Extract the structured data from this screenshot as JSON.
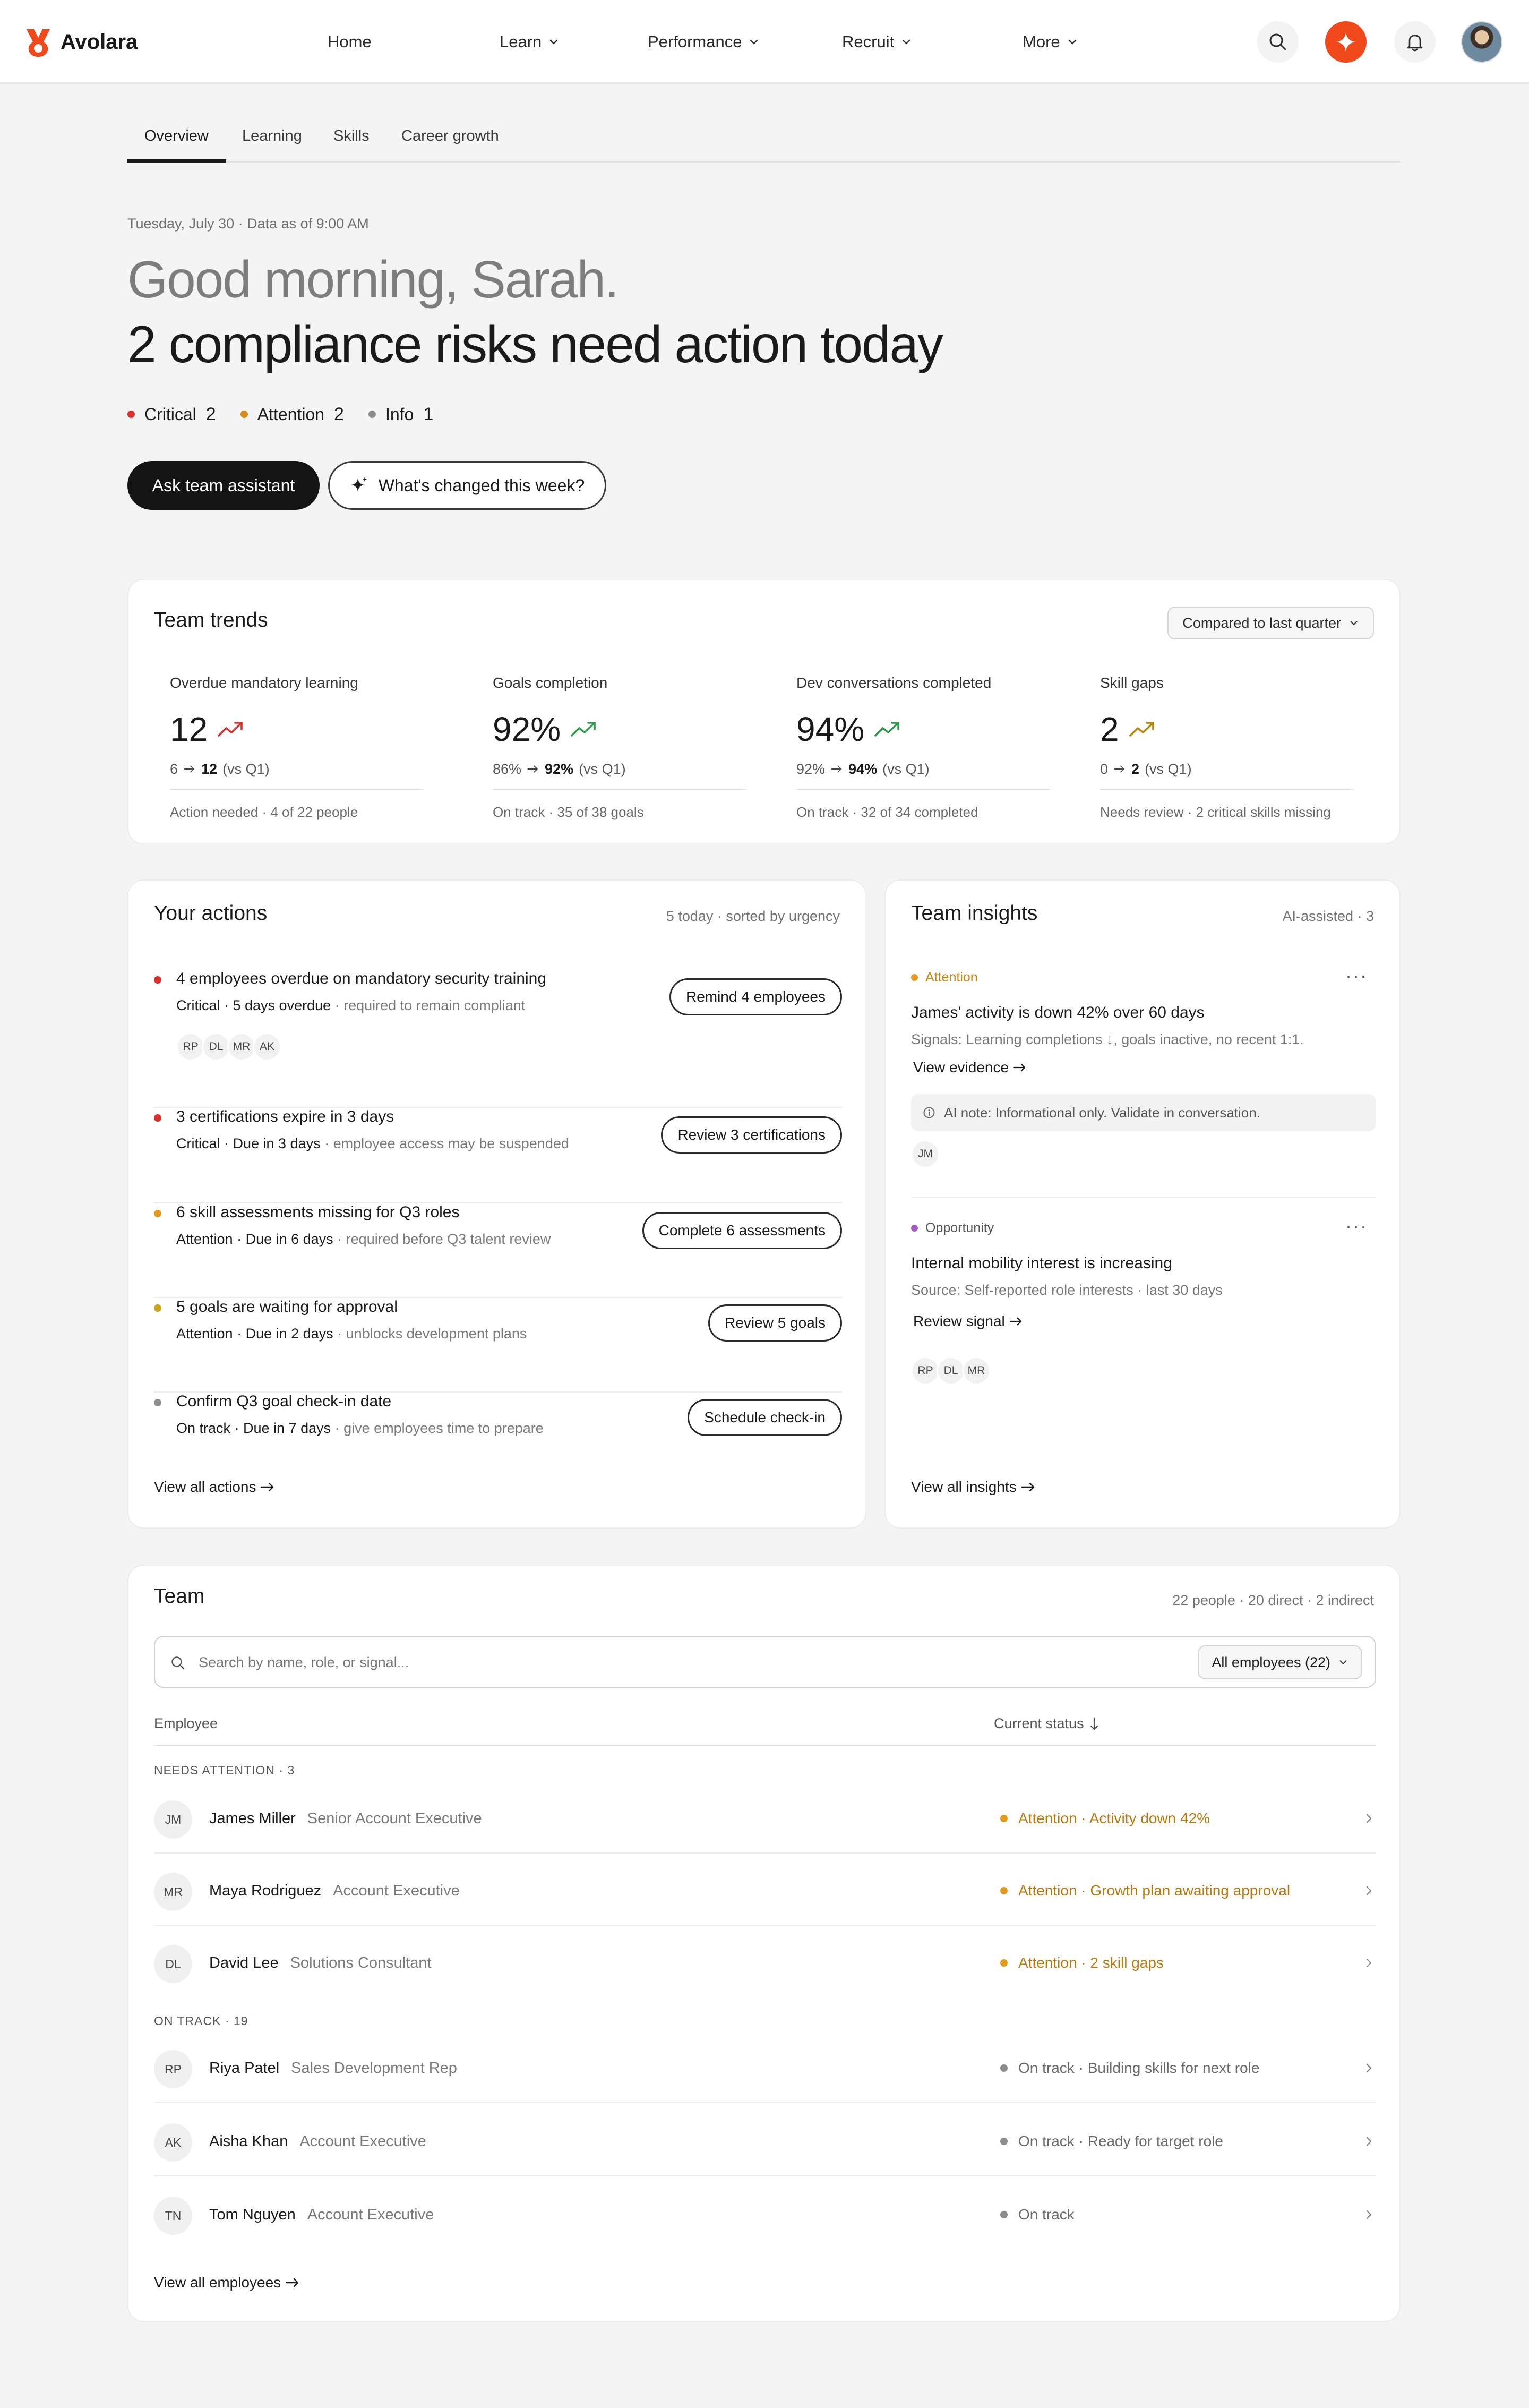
{
  "app": {
    "name": "Avolara",
    "brand_color": "#f04a1c"
  },
  "nav": {
    "items": [
      {
        "label": "Home",
        "has_menu": false
      },
      {
        "label": "Learn",
        "has_menu": true
      },
      {
        "label": "Performance",
        "has_menu": true
      },
      {
        "label": "Recruit",
        "has_menu": true
      },
      {
        "label": "More",
        "has_menu": true
      }
    ],
    "icons": [
      "search-icon",
      "sparkle-icon",
      "bell-icon",
      "user-avatar"
    ]
  },
  "tabs": [
    "Overview",
    "Learning",
    "Skills",
    "Career growth"
  ],
  "active_tab": "Overview",
  "hero": {
    "date_line": "Tuesday, July 30 · Data as of 9:00 AM",
    "greeting": "Good morning, Sarah.",
    "headline": "2 compliance risks need action today",
    "legend": [
      {
        "label": "Critical",
        "count": "2",
        "color": "#d6312b"
      },
      {
        "label": "Attention",
        "count": "2",
        "color": "#d98a1a"
      },
      {
        "label": "Info",
        "count": "1",
        "color": "#8c8c8c"
      }
    ],
    "primary_button": "Ask team assistant",
    "secondary_button": "What's changed this week?"
  },
  "trends": {
    "title": "Team trends",
    "compare_select": "Compared to last quarter",
    "metrics": [
      {
        "label": "Overdue mandatory learning",
        "value": "12",
        "trend_color": "#d6312b",
        "from": "6",
        "to": "12",
        "suffix": "(vs Q1)",
        "foot": "Action needed · 4 of 22 people"
      },
      {
        "label": "Goals completion",
        "value": "92%",
        "trend_color": "#2e9b4a",
        "from": "86%",
        "to": "92%",
        "suffix": "(vs Q1)",
        "foot": "On track · 35 of 38 goals"
      },
      {
        "label": "Dev conversations completed",
        "value": "94%",
        "trend_color": "#2e9b4a",
        "from": "92%",
        "to": "94%",
        "suffix": "(vs Q1)",
        "foot": "On track · 32 of 34 completed"
      },
      {
        "label": "Skill gaps",
        "value": "2",
        "trend_color": "#b8860b",
        "from": "0",
        "to": "2",
        "suffix": "(vs Q1)",
        "foot": "Needs review · 2 critical skills missing"
      }
    ]
  },
  "actions": {
    "title": "Your actions",
    "meta": "5 today · sorted by urgency",
    "items": [
      {
        "title": "4 employees overdue on mandatory security training",
        "status": "Critical · 5 days overdue",
        "note": " · required to remain compliant",
        "button": "Remind 4 employees",
        "color": "#d6312b",
        "avatars": [
          "RP",
          "DL",
          "MR",
          "AK"
        ]
      },
      {
        "title": "3 certifications expire in 3 days",
        "status": "Critical · Due in 3 days",
        "note": " · employee access may be suspended",
        "button": "Review 3 certifications",
        "color": "#d6312b"
      },
      {
        "title": "6 skill assessments missing for Q3 roles",
        "status": "Attention · Due in 6 days",
        "note": " · required before Q3 talent review",
        "button": "Complete 6 assessments",
        "color": "#e09a1f"
      },
      {
        "title": "5 goals are waiting for approval",
        "status": "Attention · Due in 2 days",
        "note": " · unblocks development plans",
        "button": "Review 5 goals",
        "color": "#c9a21c"
      },
      {
        "title": "Confirm Q3 goal check-in date",
        "status": "On track · Due in 7 days",
        "note": " · give employees time to prepare",
        "button": "Schedule check-in",
        "color": "#8c8c8c"
      }
    ],
    "view_all": "View all actions"
  },
  "insights": {
    "title": "Team insights",
    "meta": "AI-assisted · 3",
    "items": [
      {
        "tag": "Attention",
        "tag_color": "#c98312",
        "dot_color": "#e09a1f",
        "title": "James' activity is down 42% over 60 days",
        "sub": "Signals: Learning completions ↓, goals inactive, no recent 1:1.",
        "link": "View evidence",
        "note": "AI note: Informational only. Validate in conversation.",
        "avatars": [
          "JM"
        ]
      },
      {
        "tag": "Opportunity",
        "tag_color": "#555555",
        "dot_color": "#a35bc4",
        "title": "Internal mobility interest is increasing",
        "sub": "Source: Self-reported role interests · last 30 days",
        "link": "Review signal",
        "avatars": [
          "RP",
          "DL",
          "MR"
        ]
      }
    ],
    "view_all": "View all insights"
  },
  "team": {
    "title": "Team",
    "meta": "22 people · 20 direct · 2 indirect",
    "search_placeholder": "Search by name, role, or signal...",
    "filter": "All employees (22)",
    "col_employee": "Employee",
    "col_status": "Current status",
    "groups": [
      {
        "label": "NEEDS ATTENTION · 3",
        "rows": [
          {
            "initials": "JM",
            "name": "James Miller",
            "role": "Senior Account Executive",
            "status": "Attention · Activity down 42%",
            "color": "#b87a0e",
            "dot": "#e09a1f"
          },
          {
            "initials": "MR",
            "name": "Maya Rodriguez",
            "role": "Account Executive",
            "status": "Attention · Growth plan awaiting approval",
            "color": "#b87a0e",
            "dot": "#e09a1f"
          },
          {
            "initials": "DL",
            "name": "David Lee",
            "role": "Solutions Consultant",
            "status": "Attention · 2 skill gaps",
            "color": "#b87a0e",
            "dot": "#e09a1f"
          }
        ]
      },
      {
        "label": "ON TRACK · 19",
        "rows": [
          {
            "initials": "RP",
            "name": "Riya Patel",
            "role": "Sales Development Rep",
            "status": "On track · Building skills for next role",
            "color": "#6a6a6a",
            "dot": "#8c8c8c"
          },
          {
            "initials": "AK",
            "name": "Aisha Khan",
            "role": "Account Executive",
            "status": "On track · Ready for target role",
            "color": "#6a6a6a",
            "dot": "#8c8c8c"
          },
          {
            "initials": "TN",
            "name": "Tom Nguyen",
            "role": "Account Executive",
            "status": "On track",
            "color": "#6a6a6a",
            "dot": "#8c8c8c"
          }
        ]
      }
    ],
    "view_all": "View all employees"
  }
}
